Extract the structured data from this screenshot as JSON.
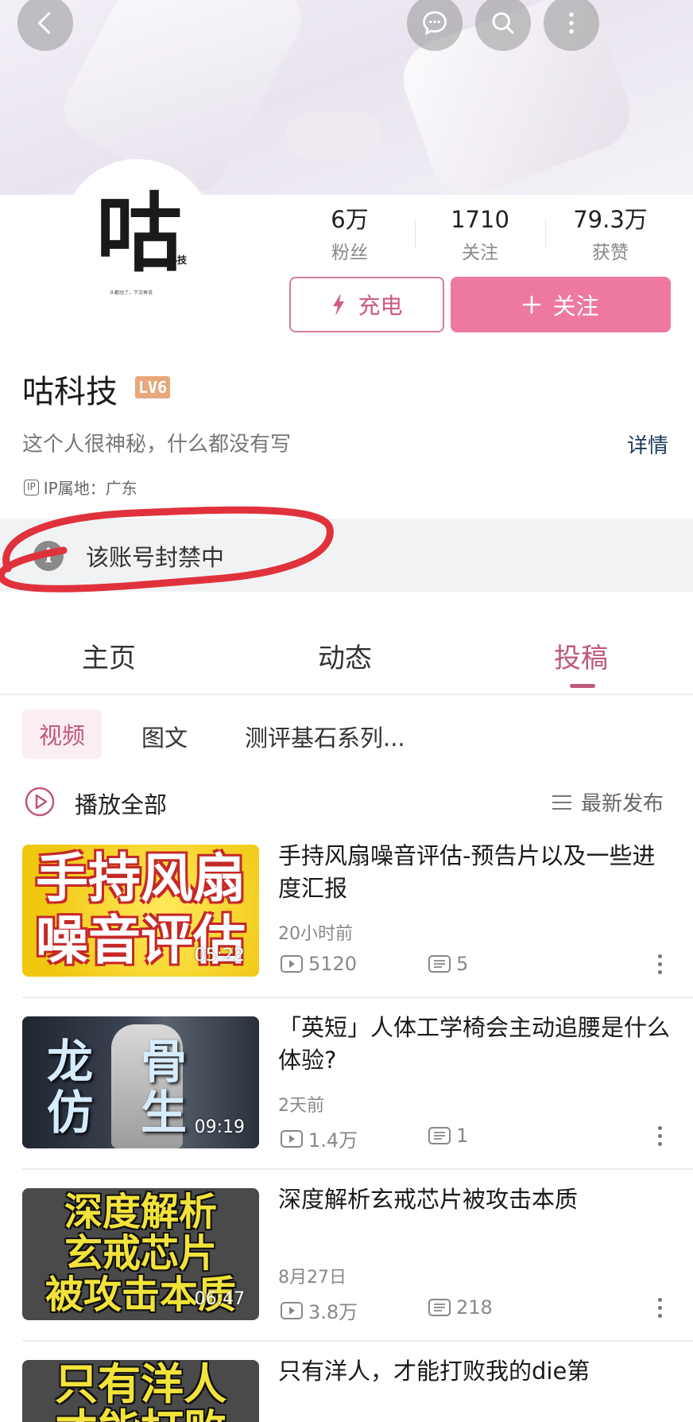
{
  "header": {
    "back_icon": "back-arrow-icon",
    "message_icon": "chat-bubble-icon",
    "search_icon": "search-icon",
    "more_icon": "more-vertical-icon"
  },
  "avatar": {
    "logo_char": "咕",
    "logo_small": "科技",
    "logo_tagline": "头都动了，下次再说"
  },
  "stats": [
    {
      "value": "6万",
      "label": "粉丝"
    },
    {
      "value": "1710",
      "label": "关注"
    },
    {
      "value": "79.3万",
      "label": "获赞"
    }
  ],
  "actions": {
    "charge_label": "充电",
    "follow_label": "关注"
  },
  "profile": {
    "name": "咕科技",
    "level": "LV6",
    "bio": "这个人很神秘，什么都没有写",
    "detail_link": "详情",
    "ip_badge": "IP",
    "ip_location": "IP属地：广东"
  },
  "notice": {
    "text": "该账号封禁中"
  },
  "tabs": [
    "主页",
    "动态",
    "投稿"
  ],
  "active_tab": "投稿",
  "sub_tabs": [
    "视频",
    "图文",
    "测评基石系列..."
  ],
  "list_header": {
    "play_all": "播放全部",
    "sort": "最新发布"
  },
  "videos": [
    {
      "title": "手持风扇噪音评估-预告片以及一些进度汇报",
      "thumb_lines": [
        "手持风扇",
        "噪音评估"
      ],
      "duration": "05:22",
      "time": "20小时前",
      "views": "5120",
      "comments": "5"
    },
    {
      "title": "「英短」人体工学椅会主动追腰是什么体验?",
      "thumb_lines": [
        "龙骨",
        "仿生"
      ],
      "duration": "09:19",
      "time": "2天前",
      "views": "1.4万",
      "comments": "1"
    },
    {
      "title": "深度解析玄戒芯片被攻击本质",
      "thumb_lines": [
        "深度解析",
        "玄戒芯片",
        "被攻击本质"
      ],
      "duration": "06:47",
      "time": "8月27日",
      "views": "3.8万",
      "comments": "218"
    },
    {
      "title": "只有洋人，才能打败我的die第",
      "thumb_lines": [
        "只有洋人",
        "才能打败"
      ],
      "duration": "",
      "time": "",
      "views": "",
      "comments": ""
    }
  ],
  "colors": {
    "accent_pink": "#ee79a0",
    "accent_text": "#c0577d",
    "level_badge": "#e8a87c",
    "annotation_red": "#e0323c"
  }
}
